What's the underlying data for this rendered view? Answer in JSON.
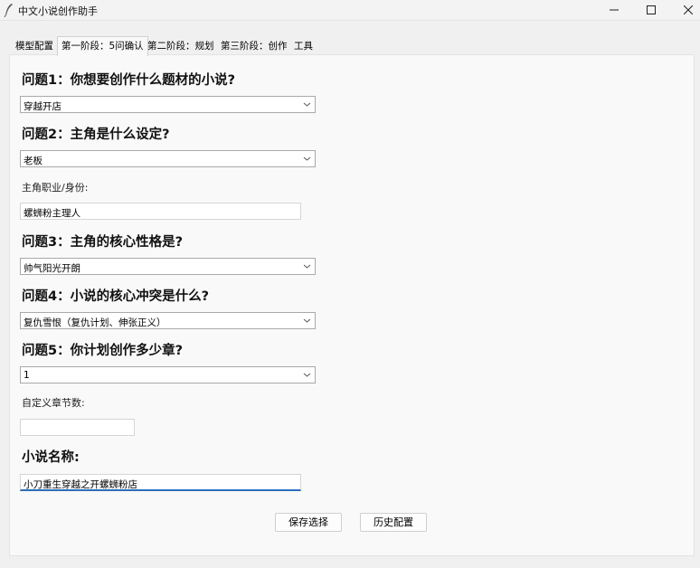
{
  "window": {
    "title": "中文小说创作助手",
    "icon": "feather-icon",
    "controls": [
      "minimize-icon",
      "maximize-icon",
      "close-icon"
    ]
  },
  "tabs": [
    {
      "label": "模型配置",
      "active": false
    },
    {
      "label": "第一阶段：5问确认",
      "active": true
    },
    {
      "label": "第二阶段：规划",
      "active": false
    },
    {
      "label": "第三阶段：创作",
      "active": false
    },
    {
      "label": "工具",
      "active": false
    }
  ],
  "form": {
    "q1": {
      "question": "问题1：你想要创作什么题材的小说?",
      "value": "穿越开店"
    },
    "q2": {
      "question": "问题2：主角是什么设定?",
      "value": "老板"
    },
    "occupation": {
      "label": "主角职业/身份:",
      "value": "螺蛳粉主理人"
    },
    "q3": {
      "question": "问题3：主角的核心性格是?",
      "value": "帅气阳光开朗"
    },
    "q4": {
      "question": "问题4：小说的核心冲突是什么?",
      "value": "复仇雪恨（复仇计划、伸张正义）"
    },
    "q5": {
      "question": "问题5：你计划创作多少章?",
      "value": "1"
    },
    "custom_chapters": {
      "label": "自定义章节数:",
      "value": ""
    },
    "novel_name": {
      "label": "小说名称:",
      "value": "小刀重生穿越之开螺蛳粉店"
    }
  },
  "buttons": {
    "save": "保存选择",
    "history": "历史配置"
  }
}
